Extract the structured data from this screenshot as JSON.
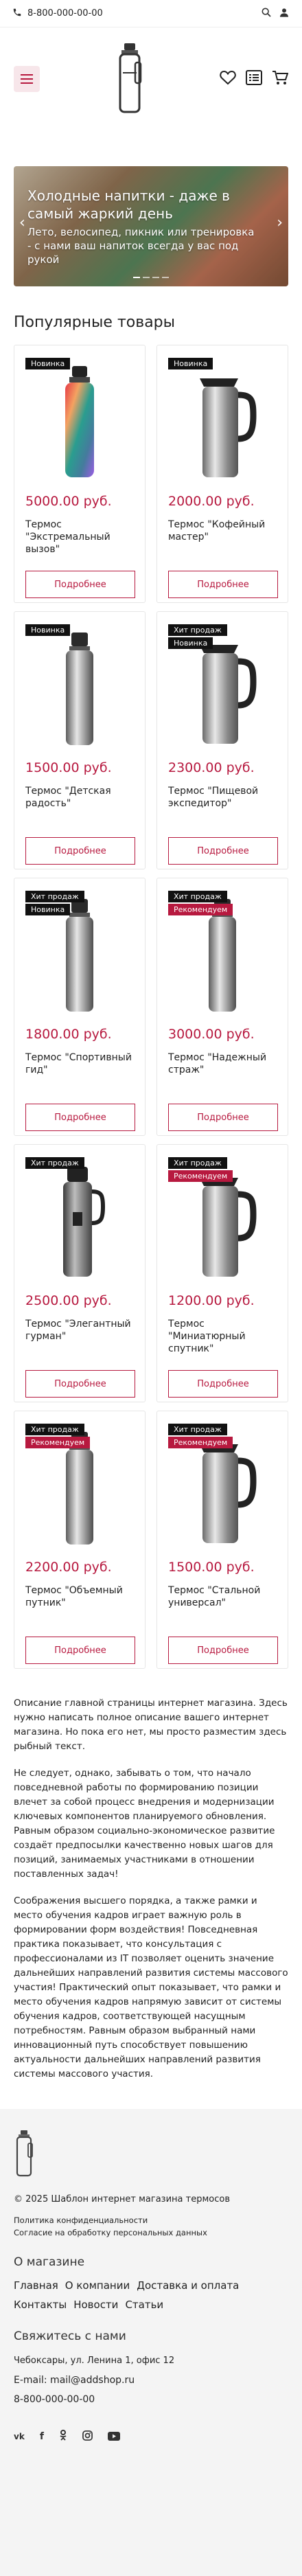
{
  "topbar": {
    "phone": "8-800-000-00-00"
  },
  "banner": {
    "title": "Холодные напитки - даже в самый жаркий день",
    "subtitle": "Лето, велосипед, пикник или тренировка - с нами ваш напиток всегда у вас под рукой",
    "prev_icon": "chevron-left-icon",
    "next_icon": "chevron-right-icon"
  },
  "section_title": "Популярные товары",
  "products": [
    {
      "name": "Термос \"Экстремальный вызов\"",
      "price": "5000.00 руб.",
      "badges": [
        {
          "text": "Новинка",
          "color": "black"
        }
      ],
      "button": "Подробнее",
      "img": "bottle-color"
    },
    {
      "name": "Термос \"Кофейный мастер\"",
      "price": "2000.00 руб.",
      "badges": [
        {
          "text": "Новинка",
          "color": "black"
        }
      ],
      "button": "Подробнее",
      "img": "jug"
    },
    {
      "name": "Термос \"Детская радость\"",
      "price": "1500.00 руб.",
      "badges": [
        {
          "text": "Новинка",
          "color": "black"
        }
      ],
      "button": "Подробнее",
      "img": "flask-tall"
    },
    {
      "name": "Термос \"Пищевой экспедитор\"",
      "price": "2300.00 руб.",
      "badges": [
        {
          "text": "Хит продаж",
          "color": "black"
        },
        {
          "text": "Новинка",
          "color": "black"
        }
      ],
      "button": "Подробнее",
      "img": "jug"
    },
    {
      "name": "Термос \"Спортивный гид\"",
      "price": "1800.00 руб.",
      "badges": [
        {
          "text": "Хит продаж",
          "color": "black"
        },
        {
          "text": "Новинка",
          "color": "black"
        }
      ],
      "button": "Подробнее",
      "img": "flask-tall"
    },
    {
      "name": "Термос \"Надежный страж\"",
      "price": "3000.00 руб.",
      "badges": [
        {
          "text": "Хит продаж",
          "color": "black"
        },
        {
          "text": "Рекомендуем",
          "color": "red"
        }
      ],
      "button": "Подробнее",
      "img": "flask-tall"
    },
    {
      "name": "Термос \"Элегантный гурман\"",
      "price": "2500.00 руб.",
      "badges": [
        {
          "text": "Хит продаж",
          "color": "black"
        }
      ],
      "button": "Подробнее",
      "img": "flask-dark"
    },
    {
      "name": "Термос \"Миниатюрный спутник\"",
      "price": "1200.00 руб.",
      "badges": [
        {
          "text": "Хит продаж",
          "color": "black"
        },
        {
          "text": "Рекомендуем",
          "color": "red"
        }
      ],
      "button": "Подробнее",
      "img": "jug"
    },
    {
      "name": "Термос \"Объемный путник\"",
      "price": "2200.00 руб.",
      "badges": [
        {
          "text": "Хит продаж",
          "color": "black"
        },
        {
          "text": "Рекомендуем",
          "color": "red"
        }
      ],
      "button": "Подробнее",
      "img": "flask-tall"
    },
    {
      "name": "Термос \"Стальной универсал\"",
      "price": "1500.00 руб.",
      "badges": [
        {
          "text": "Хит продаж",
          "color": "black"
        },
        {
          "text": "Рекомендуем",
          "color": "red"
        }
      ],
      "button": "Подробнее",
      "img": "jug"
    }
  ],
  "description": [
    "Описание главной страницы интернет магазина. Здесь нужно написать полное описание вашего интернет магазина. Но пока его нет, мы просто разместим здесь рыбный текст.",
    "Не следует, однако, забывать о том, что начало повседневной работы по формированию позиции влечет за собой процесс внедрения и модернизации ключевых компонентов планируемого обновления. Равным образом социально-экономическое развитие создаёт предпосылки качественно новых шагов для позиций, занимаемых участниками в отношении поставленных задач!",
    "Соображения высшего порядка, а также рамки и место обучения кадров играет важную роль в формировании форм воздействия! Повседневная практика показывает, что консультация с профессионалами из IT позволяет оценить значение дальнейших направлений развития системы массового участия! Практический опыт показывает, что рамки и место обучения кадров напрямую зависит от системы обучения кадров, соответствующей насущным потребностям. Равным образом выбранный нами инновационный путь способствует повышению актуальности дальнейших направлений развития системы массового участия."
  ],
  "footer": {
    "copyright": "© 2025 Шаблон интернет магазина термосов",
    "privacy": "Политика конфиденциальности",
    "consent": "Согласие на обработку персональных данных",
    "about_title": "О магазине",
    "menu": [
      "Главная",
      "О компании",
      "Доставка и оплата",
      "Контакты",
      "Новости",
      "Статьи"
    ],
    "contact_title": "Свяжитесь с нами",
    "address": "Чебоксары, ул. Ленина 1, офис 12",
    "email": "E-mail: mail@addshop.ru",
    "phone": "8-800-000-00-00",
    "social": [
      "vk-icon",
      "facebook-icon",
      "odnoklassniki-icon",
      "instagram-icon",
      "youtube-icon"
    ]
  },
  "colors": {
    "accent": "#b7193f",
    "badge_black": "#111111",
    "footer_bg": "#f4f4f4"
  }
}
